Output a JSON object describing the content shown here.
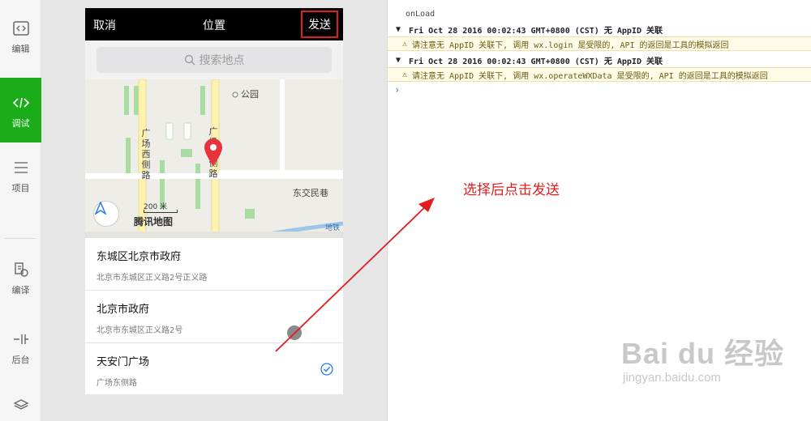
{
  "toolbar": {
    "items": [
      {
        "label": "编辑",
        "icon": "code-editor-icon"
      },
      {
        "label": "调试",
        "icon": "debug-icon",
        "active": true
      },
      {
        "label": "项目",
        "icon": "list-icon"
      },
      {
        "label": "编译",
        "icon": "compile-icon"
      },
      {
        "label": "后台",
        "icon": "background-icon"
      },
      {
        "label": "",
        "icon": "layers-icon"
      }
    ]
  },
  "phone": {
    "nav": {
      "cancel": "取消",
      "title": "位置",
      "send": "发送"
    },
    "search": {
      "placeholder": "搜索地点"
    },
    "map": {
      "labels": {
        "park": "公园",
        "west_road": "广场西侧路",
        "east_road": "广场东侧路",
        "east_street": "东交民巷",
        "metro": "地铁",
        "scale": "200 米",
        "brand": "腾讯地图"
      }
    },
    "results": [
      {
        "name": "东城区北京市政府",
        "address": "北京市东城区正义路2号正义路",
        "selected": false
      },
      {
        "name": "北京市政府",
        "address": "北京市东城区正义路2号",
        "selected": false
      },
      {
        "name": "天安门广场",
        "address": "广场东侧路",
        "selected": true
      }
    ]
  },
  "console": {
    "top": "onLoad",
    "lines": [
      {
        "type": "group",
        "text": "Fri Oct 28 2016 00:02:43 GMT+0800 (CST) 无 AppID 关联"
      },
      {
        "type": "warn",
        "text": "请注意无 AppID 关联下, 调用 wx.login 是受限的, API 的返回是工具的模拟返回"
      },
      {
        "type": "group",
        "text": "Fri Oct 28 2016 00:02:43 GMT+0800 (CST) 无 AppID 关联"
      },
      {
        "type": "warn",
        "text": "请注意无 AppID 关联下, 调用 wx.operateWXData 是受限的, API 的返回是工具的模拟返回"
      }
    ]
  },
  "annotation": {
    "text": "选择后点击发送",
    "color": "#e01e1e"
  },
  "watermark": {
    "main": "Bai du 经验",
    "url": "jingyan.baidu.com"
  },
  "colors": {
    "accent": "#1aad19",
    "highlight": "#e02020",
    "pin": "#e8333d"
  }
}
